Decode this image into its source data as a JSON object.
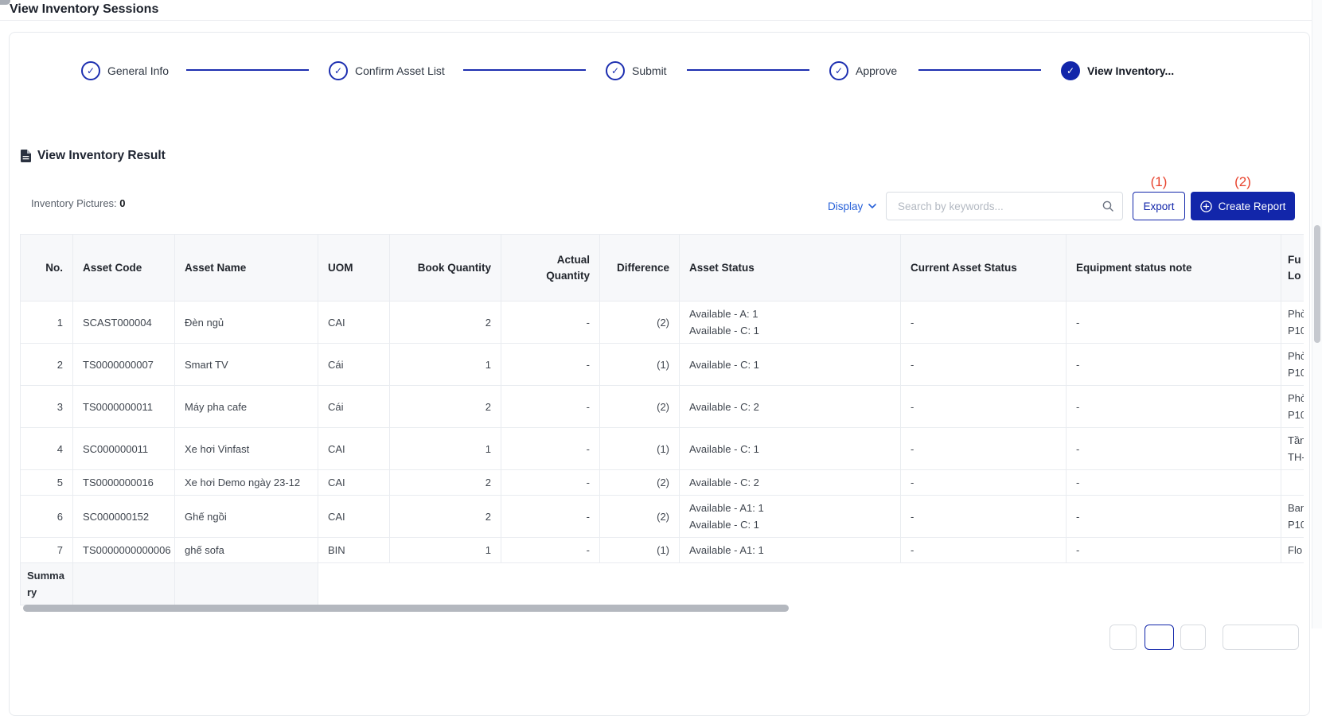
{
  "page": {
    "title": "View Inventory Sessions"
  },
  "icons": {
    "check": "✓"
  },
  "stepper": {
    "steps": [
      {
        "label": "General Info",
        "state": "completed"
      },
      {
        "label": "Confirm Asset List",
        "state": "completed"
      },
      {
        "label": "Submit",
        "state": "completed"
      },
      {
        "label": "Approve",
        "state": "completed"
      },
      {
        "label": "View Inventory...",
        "state": "active"
      }
    ]
  },
  "result_section": {
    "title": "View Inventory Result",
    "inventory_pictures_label": "Inventory Pictures:",
    "inventory_pictures_count": "0"
  },
  "toolbar": {
    "display_label": "Display",
    "search_placeholder": "Search by keywords...",
    "export_label": "Export",
    "create_report_label": "Create Report",
    "annotation_export": "(1)",
    "annotation_create_report": "(2)"
  },
  "table": {
    "columns": [
      "No.",
      "Asset Code",
      "Asset Name",
      "UOM",
      "Book Quantity",
      "Actual Quantity",
      "Difference",
      "Asset Status",
      "Current Asset Status",
      "Equipment status note"
    ],
    "last_column_lines": [
      "Fu",
      "Lo"
    ],
    "summary_label": "Summary",
    "rows": [
      {
        "no": "1",
        "asset_code": "SCAST000004",
        "asset_name": "Đèn ngủ",
        "uom": "CAI",
        "book_quantity": "2",
        "actual_quantity": "-",
        "difference": "(2)",
        "asset_status": [
          "Available - A: 1",
          "Available - C: 1"
        ],
        "current_asset_status": "-",
        "equipment_status_note": "-",
        "function_location": [
          "Phò",
          "P10"
        ]
      },
      {
        "no": "2",
        "asset_code": "TS0000000007",
        "asset_name": "Smart TV",
        "uom": "Cái",
        "book_quantity": "1",
        "actual_quantity": "-",
        "difference": "(1)",
        "asset_status": [
          "Available - C: 1"
        ],
        "current_asset_status": "-",
        "equipment_status_note": "-",
        "function_location": [
          "Phò",
          "P10"
        ]
      },
      {
        "no": "3",
        "asset_code": "TS0000000011",
        "asset_name": "Máy pha cafe",
        "uom": "Cái",
        "book_quantity": "2",
        "actual_quantity": "-",
        "difference": "(2)",
        "asset_status": [
          "Available - C: 2"
        ],
        "current_asset_status": "-",
        "equipment_status_note": "-",
        "function_location": [
          "Phò",
          "P10"
        ]
      },
      {
        "no": "4",
        "asset_code": "SC000000011",
        "asset_name": "Xe hơi Vinfast",
        "uom": "CAI",
        "book_quantity": "1",
        "actual_quantity": "-",
        "difference": "(1)",
        "asset_status": [
          "Available - C: 1"
        ],
        "current_asset_status": "-",
        "equipment_status_note": "-",
        "function_location": [
          "Tần",
          "TH-"
        ]
      },
      {
        "no": "5",
        "asset_code": "TS0000000016",
        "asset_name": "Xe hơi Demo ngày 23-12",
        "uom": "CAI",
        "book_quantity": "2",
        "actual_quantity": "-",
        "difference": "(2)",
        "asset_status": [
          "Available - C: 2"
        ],
        "current_asset_status": "-",
        "equipment_status_note": "-",
        "function_location": []
      },
      {
        "no": "6",
        "asset_code": "SC000000152",
        "asset_name": "Ghế ngồi",
        "uom": "CAI",
        "book_quantity": "2",
        "actual_quantity": "-",
        "difference": "(2)",
        "asset_status": [
          "Available - A1: 1",
          "Available - C: 1"
        ],
        "current_asset_status": "-",
        "equipment_status_note": "-",
        "function_location": [
          "Ban",
          "P10"
        ]
      },
      {
        "no": "7",
        "asset_code": "TS0000000000006",
        "asset_name": "ghế sofa",
        "uom": "BIN",
        "book_quantity": "1",
        "actual_quantity": "-",
        "difference": "(1)",
        "asset_status": [
          "Available - A1: 1"
        ],
        "current_asset_status": "-",
        "equipment_status_note": "-",
        "function_location": [
          "Flo"
        ]
      }
    ]
  },
  "colors": {
    "primary": "#1226aa",
    "link": "#2760d8",
    "annotation": "#e8432d"
  }
}
